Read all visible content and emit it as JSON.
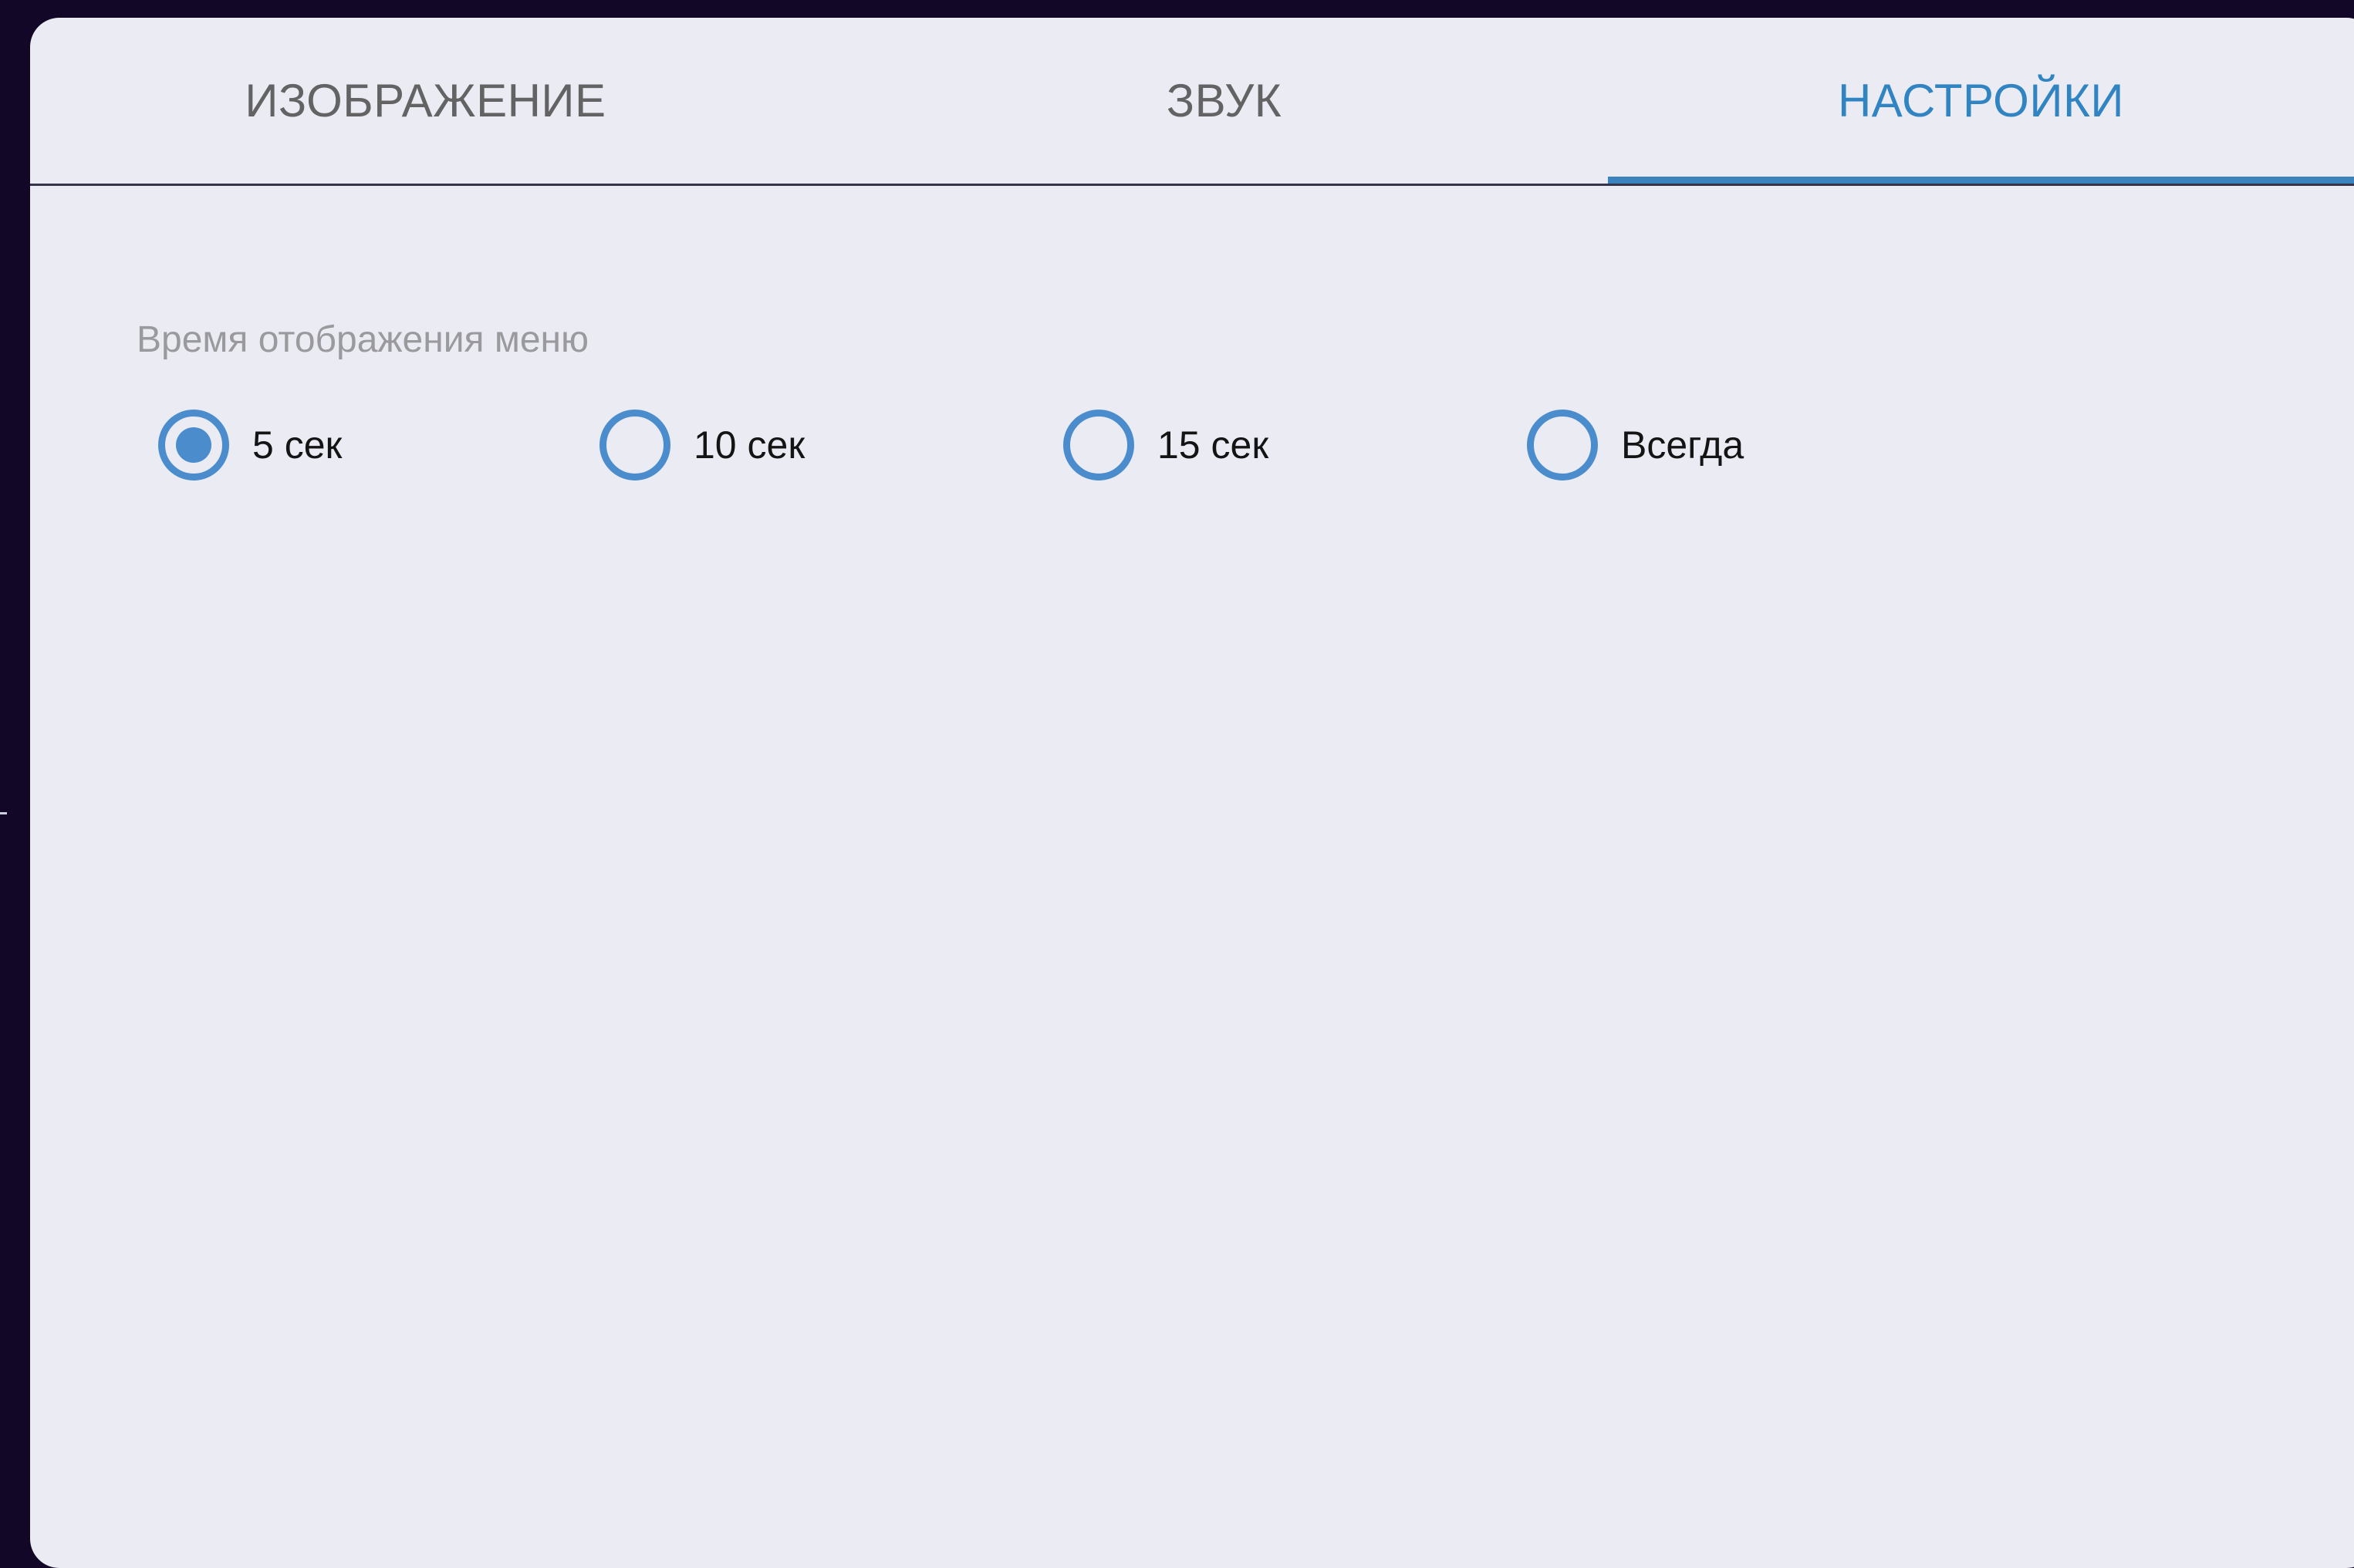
{
  "tabs": [
    {
      "label": "ИЗОБРАЖЕНИЕ",
      "active": false
    },
    {
      "label": "ЗВУК",
      "active": false
    },
    {
      "label": "НАСТРОЙКИ",
      "active": true
    }
  ],
  "settings": {
    "menu_time_label": "Время отображения меню",
    "options": [
      {
        "label": "5 сек",
        "selected": true
      },
      {
        "label": "10 сек",
        "selected": false
      },
      {
        "label": "15 сек",
        "selected": false
      },
      {
        "label": "Всегда",
        "selected": false
      }
    ]
  },
  "colors": {
    "accent": "#3a83bd",
    "active_tab_text": "#3184c2",
    "radio": "#4a8ccc",
    "panel_background": "#ebebf4",
    "outer_background": "#120726"
  }
}
